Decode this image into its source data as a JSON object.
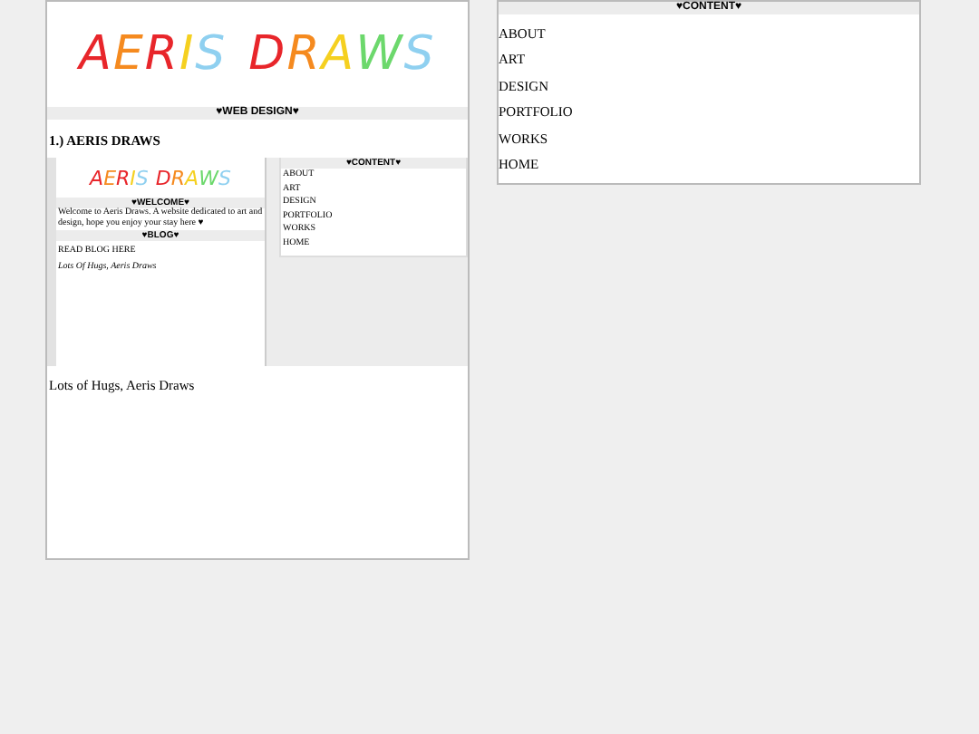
{
  "logo": {
    "words": [
      [
        {
          "letter": "A",
          "color": "#e8262b"
        },
        {
          "letter": "E",
          "color": "#f58a1f"
        },
        {
          "letter": "R",
          "color": "#e8262b"
        },
        {
          "letter": "I",
          "color": "#f5d020"
        },
        {
          "letter": "S",
          "color": "#8fd0f0"
        }
      ],
      [
        {
          "letter": "D",
          "color": "#e8262b"
        },
        {
          "letter": "R",
          "color": "#f58a1f"
        },
        {
          "letter": "A",
          "color": "#f5d020"
        },
        {
          "letter": "W",
          "color": "#6cd86c"
        },
        {
          "letter": "S",
          "color": "#8fd0f0"
        }
      ]
    ]
  },
  "section_header": "♥WEB DESIGN♥",
  "post": {
    "title": "1.) AERIS DRAWS",
    "screenshot": {
      "logo": {
        "words": [
          [
            {
              "letter": "A",
              "color": "#e8262b"
            },
            {
              "letter": "E",
              "color": "#f58a1f"
            },
            {
              "letter": "R",
              "color": "#e8262b"
            },
            {
              "letter": "I",
              "color": "#f5d020"
            },
            {
              "letter": "S",
              "color": "#8fd0f0"
            }
          ],
          [
            {
              "letter": "D",
              "color": "#e8262b"
            },
            {
              "letter": "R",
              "color": "#f58a1f"
            },
            {
              "letter": "A",
              "color": "#f5d020"
            },
            {
              "letter": "W",
              "color": "#6cd86c"
            },
            {
              "letter": "S",
              "color": "#8fd0f0"
            }
          ]
        ]
      },
      "welcome_header": "♥WELCOME♥",
      "welcome_text": "Welcome to Aeris Draws. A website dedicated to art and design, hope you enjoy your stay here ♥",
      "blog_header": "♥BLOG♥",
      "blog_link": "READ BLOG HERE",
      "signature": "Lots Of Hugs, Aeris Draws",
      "content_header": "♥CONTENT♥",
      "menu": [
        "ABOUT",
        "ART",
        "DESIGN",
        "PORTFOLIO",
        "WORKS",
        "HOME"
      ]
    },
    "signature": "Lots of Hugs, Aeris Draws"
  },
  "sidebar": {
    "header": "♥CONTENT♥",
    "items": [
      "ABOUT",
      "ART",
      "DESIGN",
      "PORTFOLIO",
      "WORKS",
      "HOME"
    ]
  }
}
